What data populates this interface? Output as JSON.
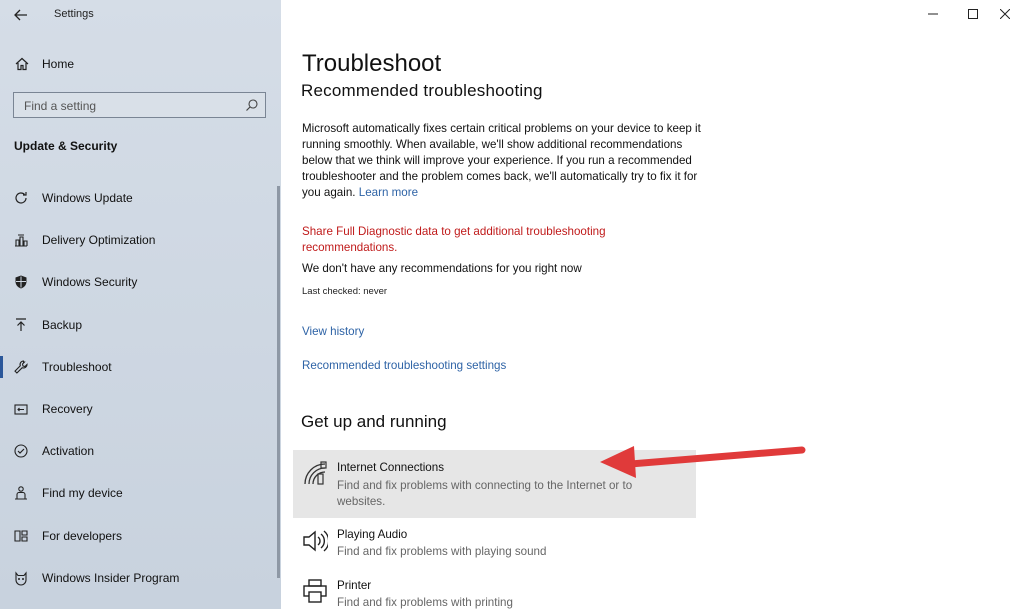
{
  "window": {
    "app_title": "Settings"
  },
  "sidebar": {
    "home_label": "Home",
    "search_placeholder": "Find a setting",
    "section_title": "Update & Security",
    "items": [
      {
        "label": "Windows Update",
        "icon": "refresh-icon"
      },
      {
        "label": "Delivery Optimization",
        "icon": "delivery-optimization-icon"
      },
      {
        "label": "Windows Security",
        "icon": "shield-icon"
      },
      {
        "label": "Backup",
        "icon": "backup-upload-icon"
      },
      {
        "label": "Troubleshoot",
        "icon": "wrench-icon",
        "selected": true
      },
      {
        "label": "Recovery",
        "icon": "recovery-icon"
      },
      {
        "label": "Activation",
        "icon": "check-circle-icon"
      },
      {
        "label": "Find my device",
        "icon": "person-pin-icon"
      },
      {
        "label": "For developers",
        "icon": "developer-tools-icon"
      },
      {
        "label": "Windows Insider Program",
        "icon": "insider-cat-icon"
      }
    ]
  },
  "main": {
    "title": "Troubleshoot",
    "subheading": "Recommended troubleshooting",
    "description": "Microsoft automatically fixes certain critical problems on your device to keep it running smoothly. When available, we'll show additional recommendations below that we think will improve your experience. If you run a recommended troubleshooter and the problem comes back, we'll automatically try to fix it for you again.",
    "learn_more": "Learn more",
    "diagnostic_warning": "Share Full Diagnostic data to get additional troubleshooting recommendations.",
    "no_recommendations": "We don't have any recommendations for you right now",
    "last_checked": "Last checked: never",
    "view_history": "View history",
    "settings_link": "Recommended troubleshooting settings",
    "section2_title": "Get up and running",
    "troubleshooters": [
      {
        "name": "Internet Connections",
        "desc": "Find and fix problems with connecting to the Internet or to websites.",
        "icon": "wifi-signal-icon",
        "highlighted": true
      },
      {
        "name": "Playing Audio",
        "desc": "Find and fix problems with playing sound",
        "icon": "speaker-icon"
      },
      {
        "name": "Printer",
        "desc": "Find and fix problems with printing",
        "icon": "printer-icon"
      }
    ]
  },
  "colors": {
    "accent": "#2b579a",
    "link": "#2e63a6",
    "warning": "#c01a1a",
    "annotation_arrow": "#e03a3a"
  }
}
